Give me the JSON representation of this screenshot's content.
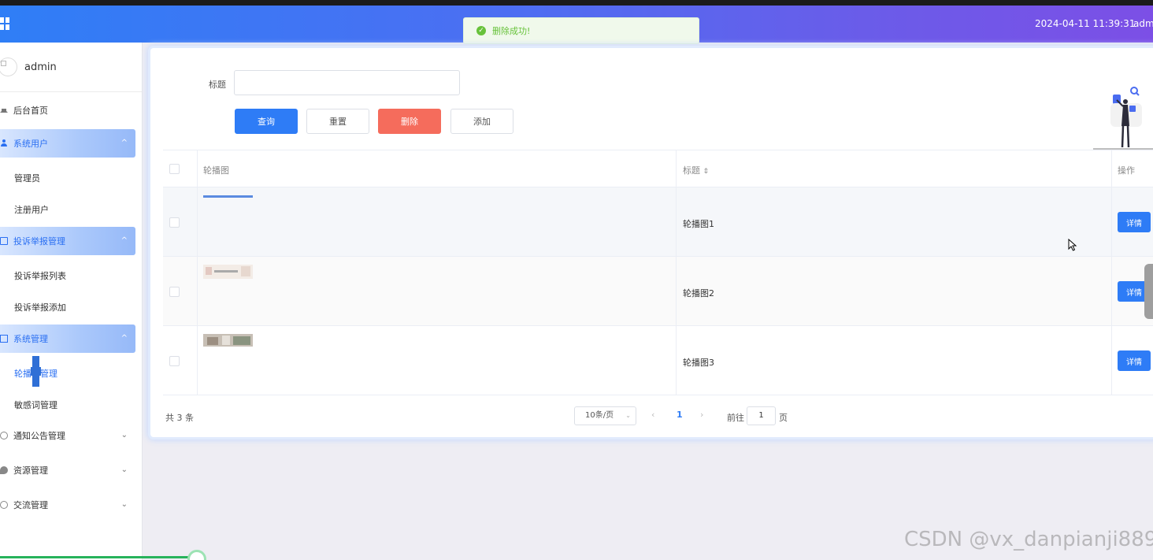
{
  "header": {
    "datetime": "2024-04-11 11:39:31",
    "user": "admin"
  },
  "toast": {
    "message": "删除成功!",
    "type": "success"
  },
  "sidebar": {
    "user_name": "admin",
    "items": [
      {
        "label": "后台首页",
        "icon": "home-icon"
      },
      {
        "label": "系统用户",
        "icon": "user-icon",
        "expanded": true,
        "children": [
          "管理员",
          "注册用户"
        ]
      },
      {
        "label": "投诉举报管理",
        "icon": "report-icon",
        "expanded": true,
        "children": [
          "投诉举报列表",
          "投诉举报添加"
        ]
      },
      {
        "label": "系统管理",
        "icon": "chart-icon",
        "expanded": true,
        "children": [
          "轮播图管理",
          "敏感词管理"
        ]
      },
      {
        "label": "通知公告管理",
        "icon": "info-icon"
      },
      {
        "label": "资源管理",
        "icon": "leaf-icon"
      },
      {
        "label": "交流管理",
        "icon": "chat-icon"
      }
    ]
  },
  "search": {
    "title_label": "标题",
    "title_value": "",
    "buttons": {
      "query": "查询",
      "reset": "重置",
      "delete": "删除",
      "add": "添加"
    }
  },
  "table": {
    "columns": [
      "轮播图",
      "标题",
      "操作"
    ],
    "rows": [
      {
        "title": "轮播图1",
        "action": "详情"
      },
      {
        "title": "轮播图2",
        "action": "详情"
      },
      {
        "title": "轮播图3",
        "action": "详情"
      }
    ]
  },
  "pagination": {
    "total_text": "共 3 条",
    "page_size": "10条/页",
    "current_page": "1",
    "goto_label": "前往",
    "goto_value": "1",
    "page_unit": "页"
  },
  "watermark": "CSDN @vx_danpianji889",
  "colors": {
    "primary": "#2e7cf6",
    "danger": "#f56c5c",
    "success": "#67c23a"
  }
}
